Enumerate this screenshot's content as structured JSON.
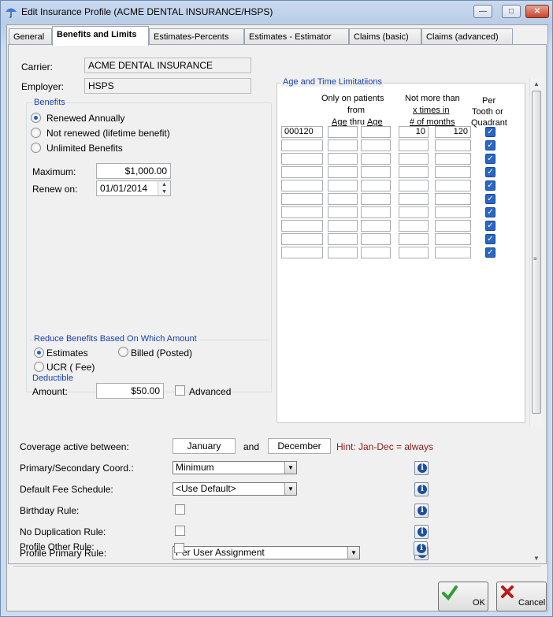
{
  "window": {
    "title": "Edit Insurance Profile (ACME DENTAL INSURANCE/HSPS)"
  },
  "tabs": [
    {
      "label": "General"
    },
    {
      "label": "Benefits and Limits"
    },
    {
      "label": "Estimates-Percents"
    },
    {
      "label": "Estimates - Estimator"
    },
    {
      "label": "Claims (basic)"
    },
    {
      "label": "Claims (advanced)"
    }
  ],
  "carrier": {
    "label": "Carrier:",
    "value": "ACME DENTAL INSURANCE"
  },
  "employer": {
    "label": "Employer:",
    "value": "HSPS"
  },
  "benefits": {
    "title": "Benefits",
    "renewed_annually": "Renewed Annually",
    "not_renewed": "Not renewed (lifetime benefit)",
    "unlimited": "Unlimited Benefits",
    "maximum_label": "Maximum:",
    "maximum_value": "$1,000.00",
    "renew_on_label": "Renew on:",
    "renew_on_value": "01/01/2014"
  },
  "reduce": {
    "title": "Reduce Benefits Based On Which Amount",
    "estimates": "Estimates",
    "billed": "Billed (Posted)",
    "ucr": "UCR ( Fee)"
  },
  "deductible": {
    "title": "Deductible",
    "amount_label": "Amount:",
    "amount_value": "$50.00",
    "advanced_label": "Advanced"
  },
  "age_time": {
    "title": "Age and Time Limitatiions",
    "hdr_patients_1": "Only on patients",
    "hdr_patients_2": "from",
    "hdr_age_thru_1": "Age",
    "hdr_age_thru_2": "thru",
    "hdr_age_thru_3": "Age",
    "hdr_more_1": "Not more than",
    "hdr_more_2": "x  times  in",
    "hdr_more_3": "# of months",
    "hdr_per_1": "Per",
    "hdr_per_2": "Tooth or",
    "hdr_per_3": "Quadrant",
    "rows": [
      {
        "code": "000120",
        "age_from": "",
        "age_thru": "",
        "times": "10",
        "months": "120"
      },
      {
        "code": "",
        "age_from": "",
        "age_thru": "",
        "times": "",
        "months": ""
      },
      {
        "code": "",
        "age_from": "",
        "age_thru": "",
        "times": "",
        "months": ""
      },
      {
        "code": "",
        "age_from": "",
        "age_thru": "",
        "times": "",
        "months": ""
      },
      {
        "code": "",
        "age_from": "",
        "age_thru": "",
        "times": "",
        "months": ""
      },
      {
        "code": "",
        "age_from": "",
        "age_thru": "",
        "times": "",
        "months": ""
      },
      {
        "code": "",
        "age_from": "",
        "age_thru": "",
        "times": "",
        "months": ""
      },
      {
        "code": "",
        "age_from": "",
        "age_thru": "",
        "times": "",
        "months": ""
      },
      {
        "code": "",
        "age_from": "",
        "age_thru": "",
        "times": "",
        "months": ""
      },
      {
        "code": "",
        "age_from": "",
        "age_thru": "",
        "times": "",
        "months": ""
      }
    ]
  },
  "coverage": {
    "label": "Coverage active between:",
    "from": "January",
    "and": "and",
    "to": "December",
    "hint": "Hint: Jan-Dec = always"
  },
  "primary_secondary": {
    "label": "Primary/Secondary Coord.:",
    "value": "Minimum"
  },
  "fee_schedule": {
    "label": "Default Fee Schedule:",
    "value": "<Use Default>"
  },
  "birthday_rule": {
    "label": "Birthday Rule:"
  },
  "no_dup_rule": {
    "label": "No Duplication Rule:"
  },
  "profile_primary": {
    "label": "Profile Primary Rule:",
    "value": "Per User Assignment"
  },
  "profile_other": {
    "label": "Profile Other Rule:"
  },
  "buttons": {
    "ok": "OK",
    "cancel": "Cancel"
  },
  "colors": {
    "hint": "#8b1a1a",
    "group_title": "#1740b0",
    "checkbox_blue": "#2a66c4"
  }
}
